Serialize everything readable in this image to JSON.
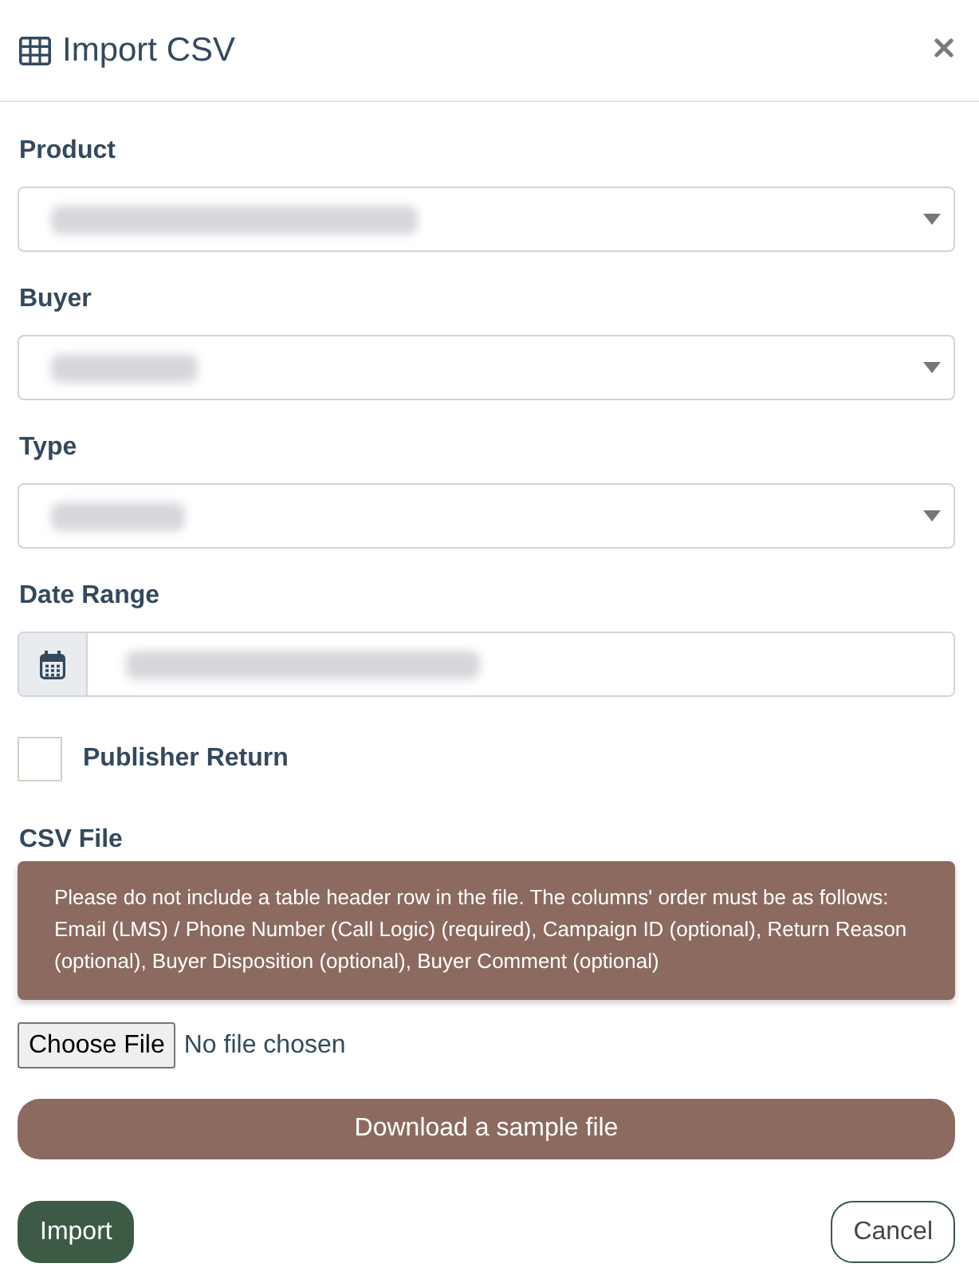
{
  "dialog": {
    "title": "Import CSV"
  },
  "fields": [
    {
      "kind": "select",
      "label": "Product",
      "redacted": true
    },
    {
      "kind": "select",
      "label": "Buyer",
      "redacted": true
    },
    {
      "kind": "select",
      "label": "Type",
      "redacted": true
    },
    {
      "kind": "date",
      "label": "Date Range",
      "redacted": true
    }
  ],
  "publisher_return": {
    "label": "Publisher Return",
    "checked": false
  },
  "csv_file": {
    "label": "CSV File",
    "notice": "Please do not include a table header row in the file. The columns' order must be as follows: Email (LMS) / Phone Number (Call Logic) (required), Campaign ID (optional), Return Reason (optional), Buyer Disposition (optional), Buyer Comment (optional)",
    "file_button": "Choose File",
    "file_status": "No file chosen"
  },
  "download_button": "Download a sample file",
  "footer_buttons": [
    {
      "label": "Import",
      "kind": "primary"
    },
    {
      "label": "Cancel",
      "kind": "secondary"
    }
  ]
}
